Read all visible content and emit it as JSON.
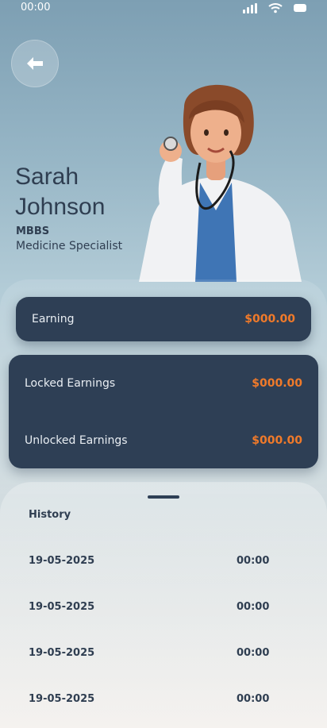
{
  "status_bar": {
    "time": "00:00"
  },
  "doctor": {
    "name": "Sarah Johnson",
    "degree": "MBBS",
    "specialty": "Medicine Specialist"
  },
  "earning": {
    "label": "Earning",
    "value": "$000.00"
  },
  "balances": [
    {
      "label": "Locked Earnings",
      "value": "$000.00"
    },
    {
      "label": "Unlocked Earnings",
      "value": "$000.00"
    }
  ],
  "history": {
    "title": "History",
    "rows": [
      {
        "date": "19-05-2025",
        "time": "00:00"
      },
      {
        "date": "19-05-2025",
        "time": "00:00"
      },
      {
        "date": "19-05-2025",
        "time": "00:00"
      },
      {
        "date": "19-05-2025",
        "time": "00:00"
      }
    ]
  },
  "colors": {
    "accent": "#f07a2a",
    "card": "#2e3f55",
    "text": "#2f3e51"
  },
  "icons": {
    "back": "arrow-left-icon",
    "signal": "signal-icon",
    "wifi": "wifi-icon",
    "battery": "battery-icon"
  }
}
